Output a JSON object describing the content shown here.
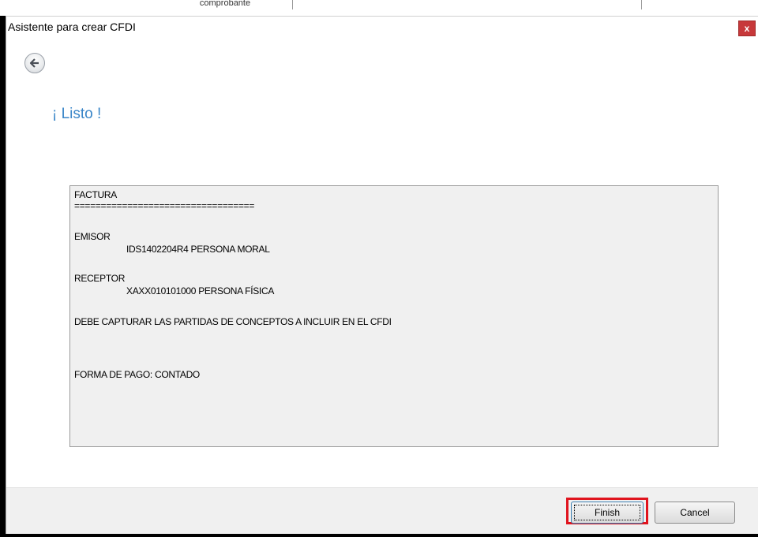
{
  "background": {
    "header_fragment": "comprobante"
  },
  "window": {
    "title": "Asistente para crear CFDI",
    "close_label": "x"
  },
  "navigation": {
    "back_icon": "back-arrow-icon"
  },
  "page": {
    "heading": "¡ Listo !"
  },
  "summary": {
    "doc_type": "FACTURA",
    "separator": "==================================",
    "issuer_label": "EMISOR",
    "issuer_value": "IDS1402204R4 PERSONA MORAL",
    "receiver_label": "RECEPTOR",
    "receiver_value": "XAXX010101000 PERSONA FÍSICA",
    "notice": "DEBE CAPTURAR LAS PARTIDAS DE CONCEPTOS A INCLUIR EN EL CFDI",
    "payment": "FORMA DE PAGO: CONTADO"
  },
  "footer": {
    "finish_label": "Finish",
    "cancel_label": "Cancel"
  },
  "colors": {
    "heading": "#3a86c8",
    "close": "#c7383a",
    "highlight": "#e0141e"
  }
}
